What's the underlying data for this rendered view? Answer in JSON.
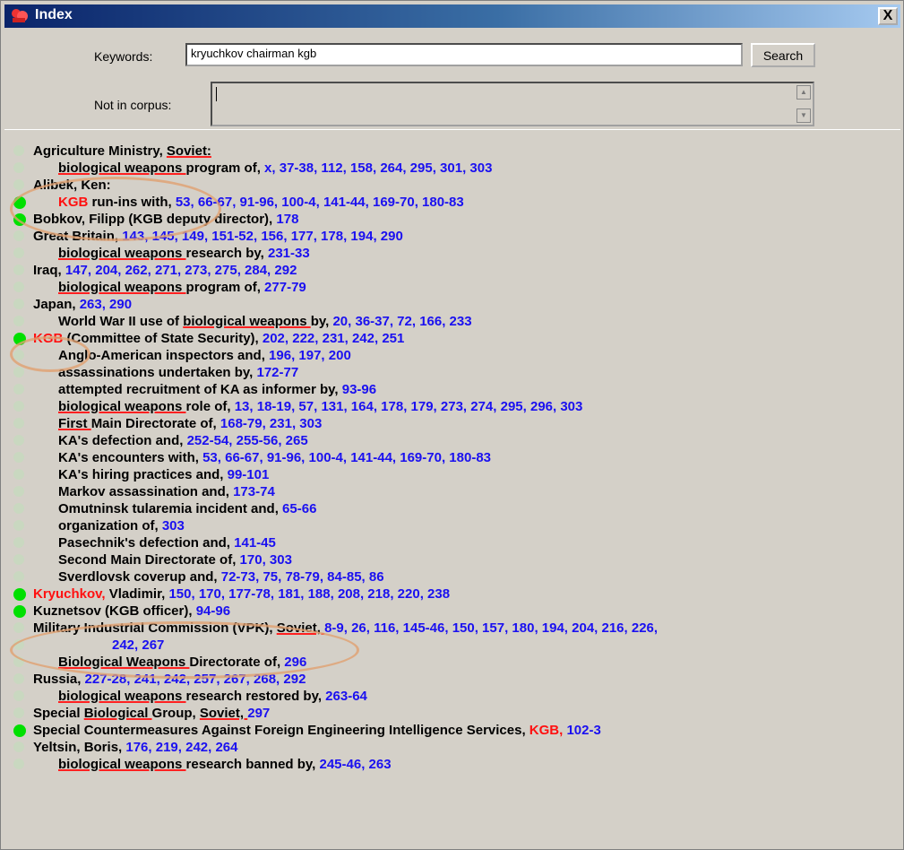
{
  "window": {
    "title": "Index",
    "close_glyph": "X",
    "app_icon": "red-figure-icon"
  },
  "form": {
    "keywords_label": "Keywords:",
    "keywords_value": "kryuchkov chairman kgb",
    "search_label": "Search",
    "not_in_corpus_label": "Not in corpus:",
    "not_in_corpus_value": ""
  },
  "entries": [
    {
      "parts": [
        {
          "t": "Agriculture Ministry, "
        },
        {
          "t": "Soviet:",
          "ul": true
        }
      ]
    },
    {
      "parts": [
        {
          "t": "biological weapons ",
          "ul": true
        },
        {
          "t": "program of, "
        },
        {
          "t": "x, 37-38, 112, 158, 264, 295, 301, 303",
          "p": true
        }
      ]
    },
    {
      "parts": [
        {
          "t": "Alibek, Ken:"
        }
      ]
    },
    {
      "parts": [
        {
          "t": "KGB ",
          "h": true
        },
        {
          "t": "run-ins with, "
        },
        {
          "t": "53, 66-67, 91-96, 100-4, 141-44, 169-70, 180-83",
          "p": true
        }
      ]
    },
    {
      "parts": [
        {
          "t": "Bobkov, Filipp (KGB deputy director), "
        },
        {
          "t": "178",
          "p": true
        }
      ]
    },
    {
      "parts": [
        {
          "t": "Great Britain, "
        },
        {
          "t": "143, 145, 149, 151-52, 156, 177, 178, 194, 290",
          "p": true
        }
      ]
    },
    {
      "parts": [
        {
          "t": "biological weapons ",
          "ul": true
        },
        {
          "t": "research by, "
        },
        {
          "t": "231-33",
          "p": true
        }
      ]
    },
    {
      "parts": [
        {
          "t": "Iraq, "
        },
        {
          "t": "147, 204, 262, 271, 273, 275, 284, 292",
          "p": true
        }
      ]
    },
    {
      "parts": [
        {
          "t": "biological weapons ",
          "ul": true
        },
        {
          "t": "program of, "
        },
        {
          "t": "277-79",
          "p": true
        }
      ]
    },
    {
      "parts": [
        {
          "t": "Japan, "
        },
        {
          "t": "263, 290",
          "p": true
        }
      ]
    },
    {
      "parts": [
        {
          "t": "World War II use of "
        },
        {
          "t": "biological weapons ",
          "ul": true
        },
        {
          "t": "by, "
        },
        {
          "t": "20, 36-37, 72, 166, 233",
          "p": true
        }
      ]
    },
    {
      "parts": [
        {
          "t": "KGB ",
          "h": true
        },
        {
          "t": "(Committee of State Security), "
        },
        {
          "t": "202, 222, 231, 242, 251",
          "p": true
        }
      ]
    },
    {
      "parts": [
        {
          "t": "Anglo-American inspectors and, "
        },
        {
          "t": "196, 197, 200",
          "p": true
        }
      ]
    },
    {
      "parts": [
        {
          "t": "assassinations undertaken by, "
        },
        {
          "t": "172-77",
          "p": true
        }
      ]
    },
    {
      "parts": [
        {
          "t": "attempted recruitment of KA as informer by, "
        },
        {
          "t": "93-96",
          "p": true
        }
      ]
    },
    {
      "parts": [
        {
          "t": "biological weapons ",
          "ul": true
        },
        {
          "t": "role of, "
        },
        {
          "t": "13, 18-19, 57, 131, 164, 178, 179, 273, 274, 295, 296, 303",
          "p": true
        }
      ]
    },
    {
      "parts": [
        {
          "t": "First ",
          "ul": true
        },
        {
          "t": "Main Directorate of, "
        },
        {
          "t": "168-79, 231, 303",
          "p": true
        }
      ]
    },
    {
      "parts": [
        {
          "t": "KA's defection and, "
        },
        {
          "t": "252-54, 255-56, 265",
          "p": true
        }
      ]
    },
    {
      "parts": [
        {
          "t": "KA's encounters with, "
        },
        {
          "t": "53, 66-67, 91-96, 100-4, 141-44, 169-70, 180-83",
          "p": true
        }
      ]
    },
    {
      "parts": [
        {
          "t": "KA's hiring practices and, "
        },
        {
          "t": "99-101",
          "p": true
        }
      ]
    },
    {
      "parts": [
        {
          "t": "Markov assassination and, "
        },
        {
          "t": "173-74",
          "p": true
        }
      ]
    },
    {
      "parts": [
        {
          "t": "Omutninsk tularemia incident and, "
        },
        {
          "t": "65-66",
          "p": true
        }
      ]
    },
    {
      "parts": [
        {
          "t": "organization of, "
        },
        {
          "t": "303",
          "p": true
        }
      ]
    },
    {
      "parts": [
        {
          "t": "Pasechnik's defection and, "
        },
        {
          "t": "141-45",
          "p": true
        }
      ]
    },
    {
      "parts": [
        {
          "t": "Second Main Directorate of, "
        },
        {
          "t": "170, 303",
          "p": true
        }
      ]
    },
    {
      "parts": [
        {
          "t": "Sverdlovsk coverup and, "
        },
        {
          "t": "72-73, 75, 78-79, 84-85, 86",
          "p": true
        }
      ]
    },
    {
      "parts": [
        {
          "t": "Kryuchkov, ",
          "h": true
        },
        {
          "t": "Vladimir, "
        },
        {
          "t": "150, 170, 177-78, 181, 188, 208, 218, 220, 238",
          "p": true
        }
      ]
    },
    {
      "parts": [
        {
          "t": "Kuznetsov (KGB officer), "
        },
        {
          "t": "94-96",
          "p": true
        }
      ]
    },
    {
      "parts": [
        {
          "t": "Military Industrial Commission (VPK), "
        },
        {
          "t": "Soviet, ",
          "ul": true
        },
        {
          "t": "8-9, 26, 116, 145-46, 150, 157, 180, 194, 204, 216, 226,",
          "p": true
        }
      ]
    },
    {
      "parts": [
        {
          "t": "242, 267",
          "p": true
        }
      ]
    },
    {
      "parts": [
        {
          "t": "Biological Weapons ",
          "ul": true
        },
        {
          "t": "Directorate of, "
        },
        {
          "t": "296",
          "p": true
        }
      ]
    },
    {
      "parts": [
        {
          "t": "Russia, "
        },
        {
          "t": "227-28, 241, 242, 257, 267, 268, 292",
          "p": true
        }
      ]
    },
    {
      "parts": [
        {
          "t": "biological weapons ",
          "ul": true
        },
        {
          "t": "research restored by, "
        },
        {
          "t": "263-64",
          "p": true
        }
      ]
    },
    {
      "parts": [
        {
          "t": "Special "
        },
        {
          "t": "Biological ",
          "ul": true
        },
        {
          "t": "Group, "
        },
        {
          "t": "Soviet, ",
          "ul": true
        },
        {
          "t": "297",
          "p": true
        }
      ]
    },
    {
      "parts": [
        {
          "t": "Special Countermeasures Against Foreign Engineering Intelligence Services, "
        },
        {
          "t": "KGB, ",
          "h": true
        },
        {
          "t": "102-3",
          "p": true
        }
      ]
    },
    {
      "parts": [
        {
          "t": "Yeltsin, Boris, "
        },
        {
          "t": "176, 219, 242, 264",
          "p": true
        }
      ]
    },
    {
      "parts": [
        {
          "t": "biological weapons ",
          "ul": true
        },
        {
          "t": "research banned by, "
        },
        {
          "t": "245-46, 263",
          "p": true
        }
      ]
    }
  ]
}
